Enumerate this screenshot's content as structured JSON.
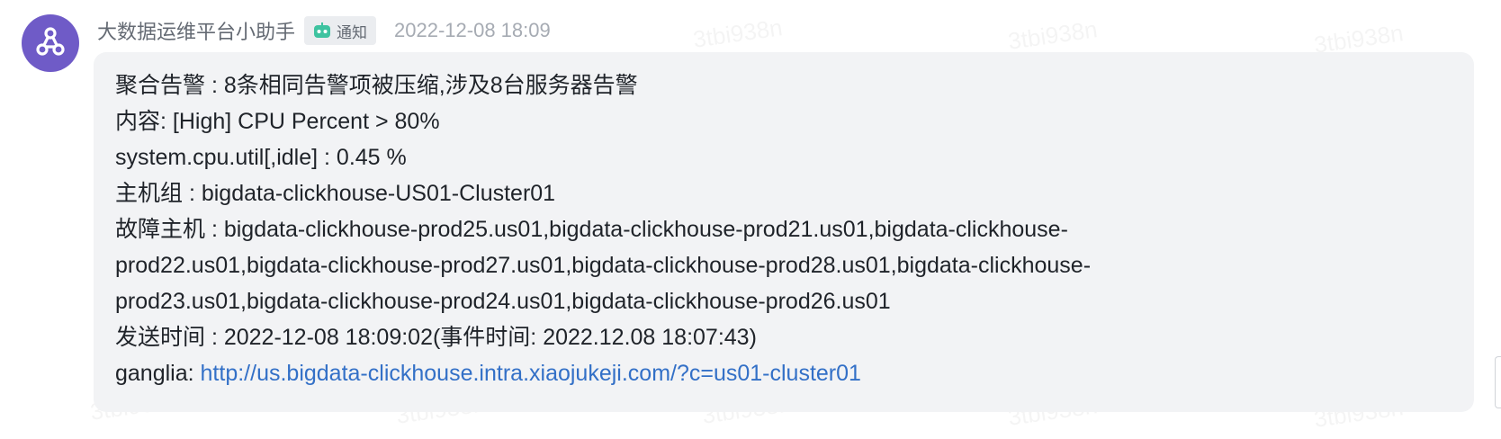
{
  "message": {
    "sender": "大数据运维平台小助手",
    "badge_label": "通知",
    "timestamp": "2022-12-08 18:09",
    "lines": {
      "aggregate": "聚合告警 : 8条相同告警项被压缩,涉及8台服务器告警",
      "content": "内容:  [High] CPU Percent > 80%",
      "metric": "system.cpu.util[,idle] : 0.45 %",
      "host_group": "主机组 : bigdata-clickhouse-US01-Cluster01",
      "faulty_hosts_1": "故障主机 : bigdata-clickhouse-prod25.us01,bigdata-clickhouse-prod21.us01,bigdata-clickhouse-",
      "faulty_hosts_2": "prod22.us01,bigdata-clickhouse-prod27.us01,bigdata-clickhouse-prod28.us01,bigdata-clickhouse-",
      "faulty_hosts_3": "prod23.us01,bigdata-clickhouse-prod24.us01,bigdata-clickhouse-prod26.us01",
      "send_time": "发送时间 : 2022-12-08 18:09:02(事件时间: 2022.12.08 18:07:43)",
      "ganglia_label": "ganglia: ",
      "ganglia_url": "http://us.bigdata-clickhouse.intra.xiaojukeji.com/?c=us01-cluster01"
    }
  },
  "watermark": {
    "text": "3tbi938n"
  },
  "icons": {
    "avatar": "webhook-icon",
    "badge": "robot-icon"
  },
  "colors": {
    "avatar_bg": "#6f5bc7",
    "badge_robot": "#3ec3a0",
    "link": "#3370c7",
    "bubble_bg": "#f2f3f5"
  }
}
